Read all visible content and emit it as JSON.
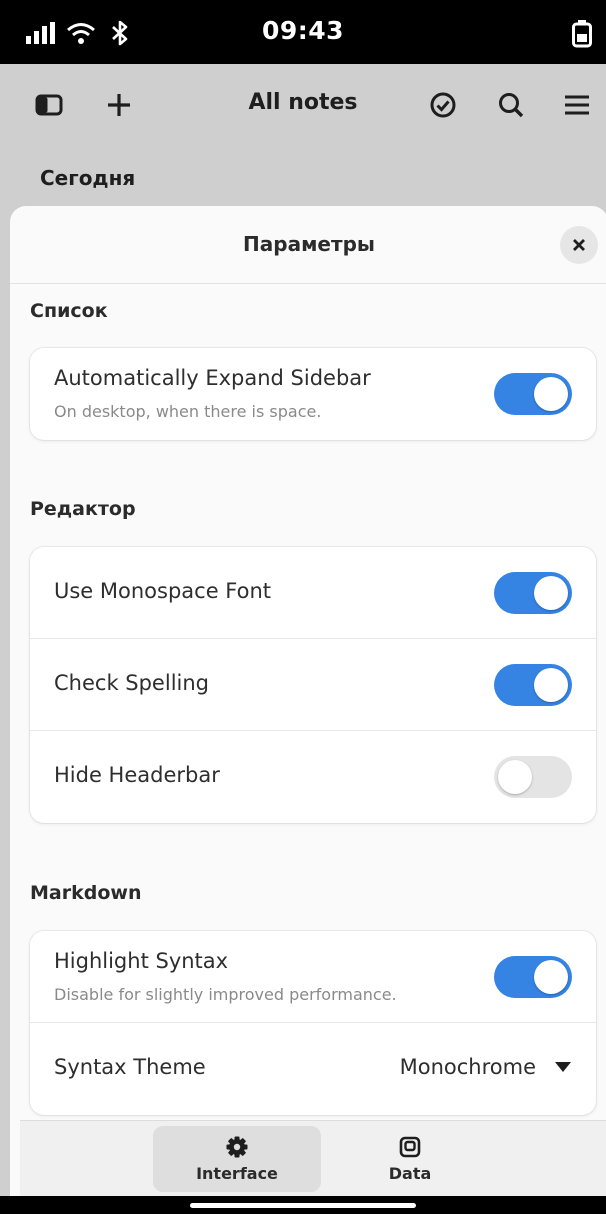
{
  "status_bar": {
    "time": "09:43",
    "icons": [
      "signal-icon",
      "wifi-icon",
      "bluetooth-icon",
      "battery-icon"
    ]
  },
  "headerbar": {
    "title": "All notes",
    "icons": [
      "sidebar-toggle-icon",
      "add-icon",
      "select-check-icon",
      "search-icon",
      "menu-icon"
    ]
  },
  "notes_list": {
    "section": "Сегодня"
  },
  "preferences": {
    "title": "Параметры",
    "close_icon": "close-icon",
    "sections": [
      {
        "title": "Список",
        "rows": [
          {
            "label": "Automatically Expand Sidebar",
            "sublabel": "On desktop, when there is space.",
            "state": true
          }
        ]
      },
      {
        "title": "Редактор",
        "rows": [
          {
            "label": "Use Monospace Font",
            "state": true
          },
          {
            "label": "Check Spelling",
            "state": true
          },
          {
            "label": "Hide Headerbar",
            "state": false
          }
        ]
      },
      {
        "title": "Markdown",
        "rows": [
          {
            "label": "Highlight Syntax",
            "sublabel": "Disable for slightly improved performance.",
            "state": true
          },
          {
            "label": "Syntax Theme",
            "value": "Monochrome"
          }
        ]
      }
    ]
  },
  "switcher": {
    "items": [
      {
        "label": "Interface",
        "icon": "gear-icon",
        "active": true
      },
      {
        "label": "Data",
        "icon": "data-icon",
        "active": false
      }
    ]
  },
  "colors": {
    "accent": "#3584e4",
    "switch_off": "#e4e4e4",
    "dim_background": "#cfcfcf"
  }
}
